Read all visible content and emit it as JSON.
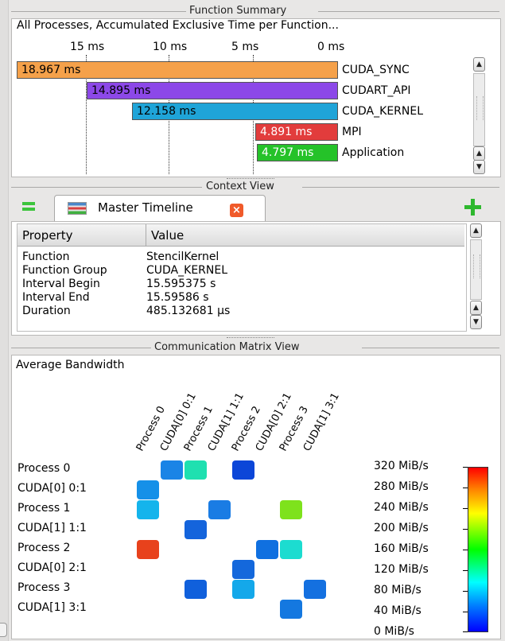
{
  "function_summary": {
    "title": "Function Summary",
    "subtitle": "All Processes, Accumulated Exclusive Time per Function...",
    "ticks": [
      "15 ms",
      "10 ms",
      "5 ms",
      "0 ms"
    ],
    "bars": [
      {
        "label": "CUDA_SYNC",
        "value_text": "18.967 ms",
        "value": 18.967,
        "color": "#f5a14a"
      },
      {
        "label": "CUDART_API",
        "value_text": "14.895 ms",
        "value": 14.895,
        "color": "#8c48e8"
      },
      {
        "label": "CUDA_KERNEL",
        "value_text": "12.158 ms",
        "value": 12.158,
        "color": "#1fa4d8"
      },
      {
        "label": "MPI",
        "value_text": "4.891 ms",
        "value": 4.891,
        "color": "#e23c3c"
      },
      {
        "label": "Application",
        "value_text": "4.797 ms",
        "value": 4.797,
        "color": "#25c229"
      }
    ],
    "scroll_up_icon": "arrow-up",
    "scroll_down_icon": "arrow-down"
  },
  "context_view": {
    "title": "Context View",
    "tab_label": "Master Timeline",
    "columns": [
      "Property",
      "Value"
    ],
    "rows": [
      {
        "property": "Function",
        "value": "StencilKernel"
      },
      {
        "property": "Function Group",
        "value": "CUDA_KERNEL"
      },
      {
        "property": "Interval Begin",
        "value": "15.595375 s"
      },
      {
        "property": "Interval End",
        "value": "15.59586 s"
      },
      {
        "property": "Duration",
        "value": "485.132681 µs"
      }
    ]
  },
  "communication_matrix": {
    "title": "Communication Matrix View",
    "subtitle": "Average Bandwidth",
    "senders": [
      "Process 0",
      "CUDA[0] 0:1",
      "Process 1",
      "CUDA[1] 1:1",
      "Process 2",
      "CUDA[0] 2:1",
      "Process 3",
      "CUDA[1] 3:1"
    ],
    "receivers": [
      "Process 0",
      "CUDA[0] 0:1",
      "Process 1",
      "CUDA[1] 1:1",
      "Process 2",
      "CUDA[0] 2:1",
      "Process 3",
      "CUDA[1] 3:1"
    ],
    "color_scale": [
      "320 MiB/s",
      "280 MiB/s",
      "240 MiB/s",
      "200 MiB/s",
      "160 MiB/s",
      "120 MiB/s",
      "80 MiB/s",
      "40 MiB/s",
      "0 MiB/s"
    ],
    "cells": [
      {
        "row": 0,
        "col": 1,
        "color": "#1a84e6"
      },
      {
        "row": 0,
        "col": 2,
        "color": "#1fe0b0"
      },
      {
        "row": 0,
        "col": 4,
        "color": "#0c46d8"
      },
      {
        "row": 1,
        "col": 0,
        "color": "#1590e8"
      },
      {
        "row": 2,
        "col": 0,
        "color": "#14b4ec"
      },
      {
        "row": 2,
        "col": 3,
        "color": "#1a7ce4"
      },
      {
        "row": 2,
        "col": 6,
        "color": "#7ee21c"
      },
      {
        "row": 3,
        "col": 2,
        "color": "#1464dc"
      },
      {
        "row": 4,
        "col": 0,
        "color": "#e8421c"
      },
      {
        "row": 4,
        "col": 5,
        "color": "#1070e0"
      },
      {
        "row": 4,
        "col": 6,
        "color": "#1cdcd0"
      },
      {
        "row": 5,
        "col": 4,
        "color": "#1468dc"
      },
      {
        "row": 6,
        "col": 2,
        "color": "#1060dc"
      },
      {
        "row": 6,
        "col": 4,
        "color": "#14a8ea"
      },
      {
        "row": 6,
        "col": 7,
        "color": "#1470e0"
      },
      {
        "row": 7,
        "col": 6,
        "color": "#1478e0"
      }
    ]
  }
}
